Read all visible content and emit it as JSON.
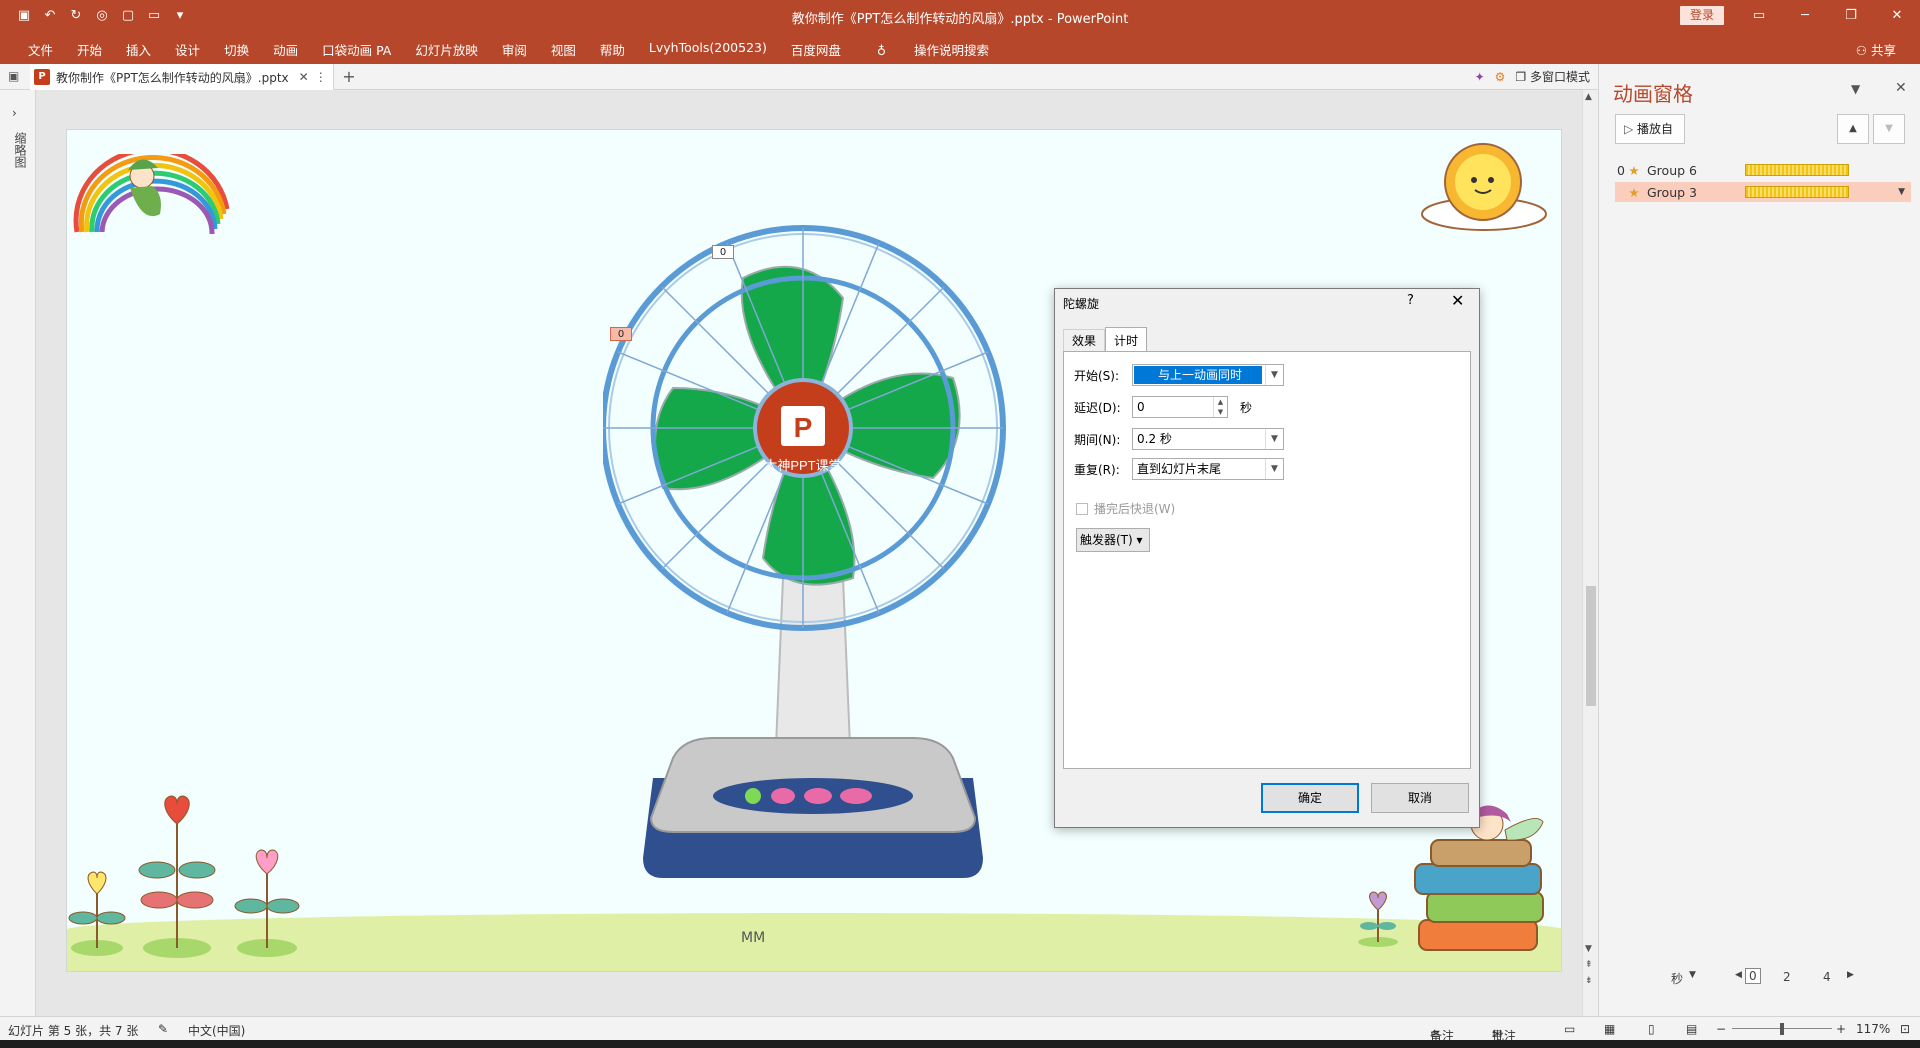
{
  "window": {
    "title": "教你制作《PPT怎么制作转动的风扇》.pptx - PowerPoint",
    "login": "登录"
  },
  "ribbon": {
    "tabs": [
      "文件",
      "开始",
      "插入",
      "设计",
      "切换",
      "动画",
      "口袋动画 PA",
      "幻灯片放映",
      "审阅",
      "视图",
      "帮助",
      "LvyhTools(200523)",
      "百度网盘",
      "操作说明搜索"
    ],
    "share": "共享"
  },
  "doc_tab": {
    "title": "教你制作《PPT怎么制作转动的风扇》.pptx",
    "multiwindow": "多窗口模式"
  },
  "thumb_panel": {
    "label": "缩略图"
  },
  "slide": {
    "tag_a": "0",
    "tag_b": "0",
    "logo_text": "P",
    "watermark": "大神PPT课堂",
    "ground_text": "MM"
  },
  "dialog": {
    "title": "陀螺旋",
    "help": "?",
    "tabs": [
      "效果",
      "计时"
    ],
    "start_label": "开始(S):",
    "start_value": "与上一动画同时",
    "delay_label": "延迟(D):",
    "delay_value": "0",
    "delay_unit": "秒",
    "duration_label": "期间(N):",
    "duration_value": "0.2 秒",
    "repeat_label": "重复(R):",
    "repeat_value": "直到幻灯片末尾",
    "rewind_label": "播完后快退(W)",
    "trigger_label": "触发器(T)",
    "ok": "确定",
    "cancel": "取消"
  },
  "anim_pane": {
    "title": "动画窗格",
    "play": "播放自",
    "items": [
      {
        "num": "0",
        "name": "Group 6"
      },
      {
        "num": "",
        "name": "Group 3"
      }
    ],
    "timeline_unit": "秒",
    "timeline_ticks": [
      "0",
      "2",
      "4"
    ]
  },
  "status": {
    "slide_info": "幻灯片 第 5 张，共 7 张",
    "language": "中文(中国)",
    "notes": "备注",
    "comments": "批注",
    "zoom": "117%"
  },
  "colors": {
    "accent": "#b7472a",
    "fan_blade": "#14a84a",
    "fan_ring": "#5b9bd5",
    "dialog_select": "#0078d7"
  }
}
